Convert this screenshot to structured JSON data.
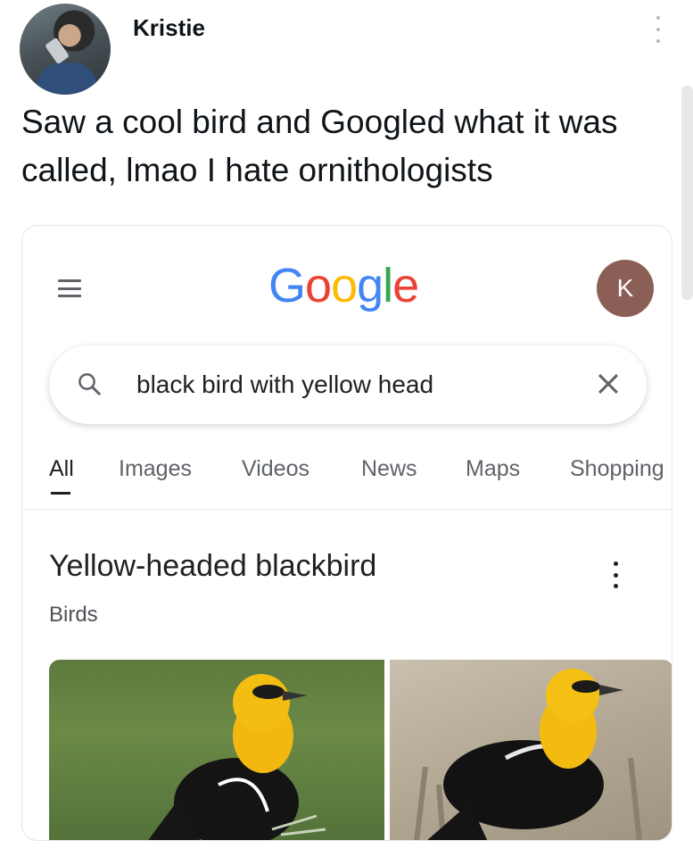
{
  "post": {
    "author": "Kristie",
    "text": "Saw a cool bird and Googled what it was called, lmao I hate ornithologists"
  },
  "google": {
    "logo_letters": [
      {
        "ch": "G",
        "color": "#4285F4"
      },
      {
        "ch": "o",
        "color": "#EA4335"
      },
      {
        "ch": "o",
        "color": "#FBBC05"
      },
      {
        "ch": "g",
        "color": "#4285F4"
      },
      {
        "ch": "l",
        "color": "#34A853"
      },
      {
        "ch": "e",
        "color": "#EA4335"
      }
    ],
    "account_initial": "K",
    "account_color": "#8b5e56",
    "search_query": "black bird with yellow head",
    "tabs": [
      {
        "label": "All",
        "active": true
      },
      {
        "label": "Images",
        "active": false
      },
      {
        "label": "Videos",
        "active": false
      },
      {
        "label": "News",
        "active": false
      },
      {
        "label": "Maps",
        "active": false
      },
      {
        "label": "Shopping",
        "active": false
      }
    ],
    "result": {
      "title": "Yellow-headed blackbird",
      "subtitle": "Birds"
    },
    "icons": [
      "menu-icon",
      "search-icon",
      "close-icon",
      "more-vert-icon"
    ]
  }
}
